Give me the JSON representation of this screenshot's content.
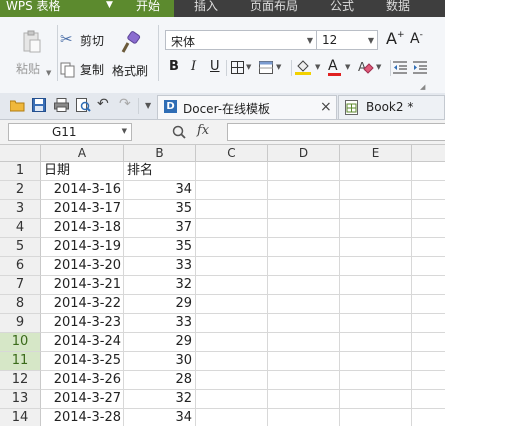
{
  "menubar": {
    "app_button": "WPS 表格",
    "tabs": [
      {
        "label": "开始",
        "active": true
      },
      {
        "label": "插入",
        "active": false
      },
      {
        "label": "页面布局",
        "active": false
      },
      {
        "label": "公式",
        "active": false
      },
      {
        "label": "数据",
        "active": false
      }
    ]
  },
  "ribbon": {
    "paste_label": "粘贴",
    "cut_label": "剪切",
    "copy_label": "复制",
    "format_painter_label": "格式刷",
    "font_name": "宋体",
    "font_size": "12",
    "bold": "B",
    "italic": "I",
    "underline": "U",
    "grow_font": "A",
    "shrink_font": "A",
    "font_color_letter": "A"
  },
  "qbar": {
    "tabs": [
      {
        "label": "Docer-在线模板",
        "icon": "docer-icon",
        "close": "×"
      },
      {
        "label": "Book2 *",
        "icon": "sheet-icon"
      }
    ]
  },
  "formula_bar": {
    "name_box": "G11",
    "fx": "fx",
    "content": ""
  },
  "colors": {
    "accent_green": "#5c8a2e",
    "menubar_bg": "#3e3e3e",
    "selected_row_header": "#d6e7c7"
  },
  "sheet": {
    "columns": [
      "A",
      "B",
      "C",
      "D",
      "E"
    ],
    "rows": [
      {
        "n": "1",
        "a": "日期",
        "b": "排名"
      },
      {
        "n": "2",
        "a": "2014-3-16",
        "b": "34"
      },
      {
        "n": "3",
        "a": "2014-3-17",
        "b": "35"
      },
      {
        "n": "4",
        "a": "2014-3-18",
        "b": "37"
      },
      {
        "n": "5",
        "a": "2014-3-19",
        "b": "35"
      },
      {
        "n": "6",
        "a": "2014-3-20",
        "b": "33"
      },
      {
        "n": "7",
        "a": "2014-3-21",
        "b": "32"
      },
      {
        "n": "8",
        "a": "2014-3-22",
        "b": "29"
      },
      {
        "n": "9",
        "a": "2014-3-23",
        "b": "33"
      },
      {
        "n": "10",
        "a": "2014-3-24",
        "b": "29"
      },
      {
        "n": "11",
        "a": "2014-3-25",
        "b": "30"
      },
      {
        "n": "12",
        "a": "2014-3-26",
        "b": "28"
      },
      {
        "n": "13",
        "a": "2014-3-27",
        "b": "32"
      },
      {
        "n": "14",
        "a": "2014-3-28",
        "b": "34"
      }
    ],
    "selected_rows": [
      "10",
      "11"
    ]
  }
}
